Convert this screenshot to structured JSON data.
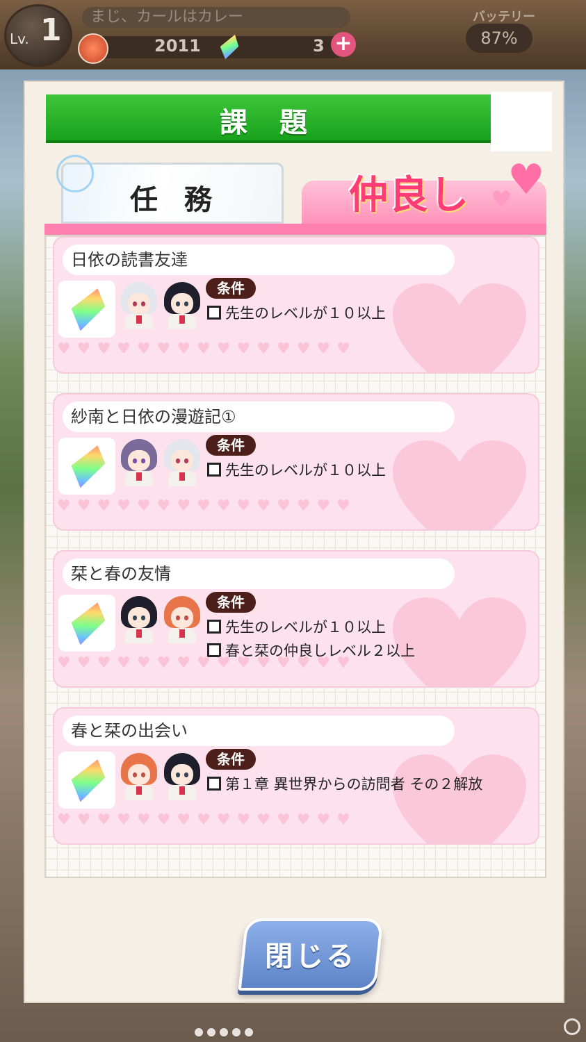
{
  "status": {
    "level_label": "Lv.",
    "level": "1",
    "player_name": "まじ、カールはカレー",
    "coins": "2011",
    "gems": "3",
    "battery_label": "バッテリー",
    "battery": "87%"
  },
  "dialog": {
    "title": "課 題",
    "tabs": {
      "mission": "任 務",
      "friendship": "仲良し"
    },
    "condition_label": "条件",
    "close_label": "閉じる",
    "quests": [
      {
        "title": "日依の読書友達",
        "characters": [
          "white-hair-girl",
          "black-hair-girl"
        ],
        "conditions": [
          "先生のレベルが１０以上"
        ]
      },
      {
        "title": "紗南と日依の漫遊記①",
        "characters": [
          "purple-hair-girl",
          "white-hair-girl"
        ],
        "conditions": [
          "先生のレベルが１０以上"
        ]
      },
      {
        "title": "栞と春の友情",
        "characters": [
          "black-hair-girl",
          "orange-hair-girl"
        ],
        "conditions": [
          "先生のレベルが１０以上",
          "春と栞の仲良しレベル２以上"
        ]
      },
      {
        "title": "春と栞の出会い",
        "characters": [
          "orange-hair-girl",
          "black-hair-girl"
        ],
        "conditions": [
          "第１章 異世界からの訪問者 その２解放"
        ]
      }
    ]
  },
  "colors": {
    "title_green": "#18a11c",
    "friend_pink": "#ff3c76",
    "card_pink": "#fde1ec",
    "close_blue": "#5d84c8"
  }
}
